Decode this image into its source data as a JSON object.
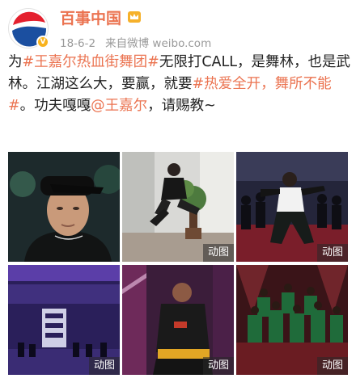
{
  "post": {
    "username": "百事中国",
    "verified_badge": "V",
    "date": "18-6-2",
    "source": "来自微博 weibo.com",
    "text": {
      "p1": "为",
      "tag1": "#王嘉尔热血街舞团#",
      "p2": "无限打CALL，是舞林，也是武林。江湖这么大，要赢，就要",
      "tag2": "#热爱全开，舞所不能#",
      "p3": "。功夫嘎嘎",
      "mention": "@王嘉尔",
      "p4": "，请赐教~"
    }
  },
  "media": {
    "gif_label": "动图",
    "items": [
      {
        "id": 1,
        "gif": false
      },
      {
        "id": 2,
        "gif": true
      },
      {
        "id": 3,
        "gif": true
      },
      {
        "id": 4,
        "gif": true
      },
      {
        "id": 5,
        "gif": true
      },
      {
        "id": 6,
        "gif": true
      }
    ]
  },
  "colors": {
    "username": "#eb7350",
    "link": "#eb7350",
    "meta": "#9a9a9a",
    "verified": "#f8b31e",
    "pepsi_blue": "#1b4fa0",
    "pepsi_red": "#e4202e"
  },
  "icons": [
    "pepsi-logo",
    "verified-badge-icon",
    "crown-icon"
  ]
}
